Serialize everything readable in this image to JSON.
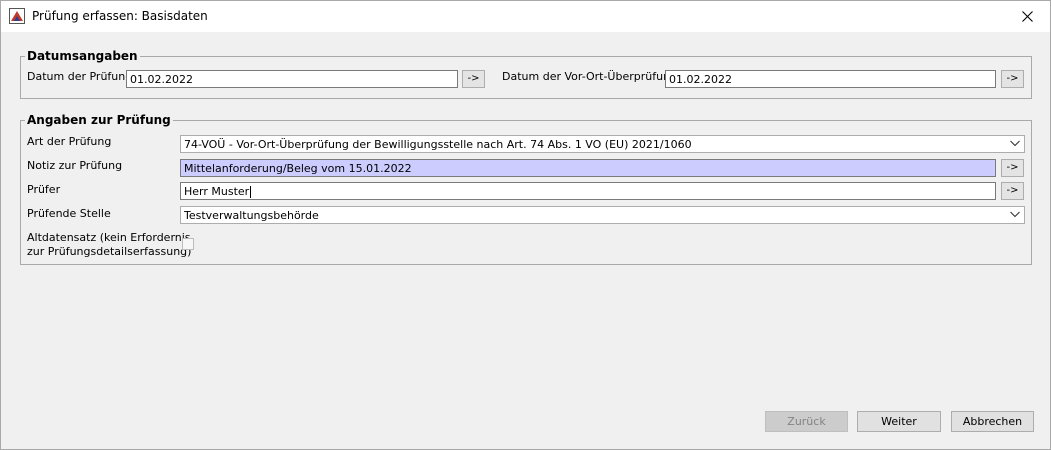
{
  "window": {
    "title": "Prüfung erfassen: Basisdaten"
  },
  "datum_group": {
    "legend": "Datumsangaben",
    "datum_label": "Datum der Prüfung",
    "datum_value": "01.02.2022",
    "vorort_label": "Datum der Vor-Ort-Überprüfung",
    "vorort_value": "01.02.2022"
  },
  "pruefung_group": {
    "legend": "Angaben zur Prüfung",
    "art_label": "Art der Prüfung",
    "art_value": "74-VOÜ - Vor-Ort-Überprüfung der Bewilligungsstelle nach Art. 74 Abs. 1 VO (EU) 2021/1060",
    "notiz_label": "Notiz zur Prüfung",
    "notiz_value": "Mittelanforderung/Beleg vom 15.01.2022",
    "pruefer_label": "Prüfer",
    "pruefer_value": "Herr Muster",
    "stelle_label": "Prüfende Stelle",
    "stelle_value": "Testverwaltungsbehörde",
    "alt_label_line1": "Altdatensatz (kein Erfordernis",
    "alt_label_line2": "zur Prüfungsdetailserfassung)"
  },
  "arrow_button_label": "->",
  "buttons": {
    "back": "Zurück",
    "next": "Weiter",
    "cancel": "Abbrechen"
  }
}
